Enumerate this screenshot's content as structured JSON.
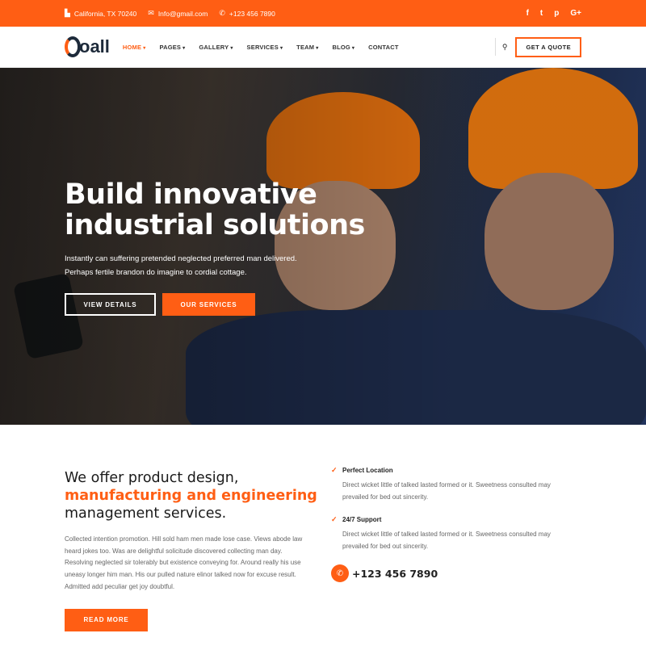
{
  "topbar": {
    "address": "California, TX 70240",
    "email": "Info@gmail.com",
    "phone": "+123 456 7890",
    "social": [
      "f",
      "t",
      "p",
      "G+"
    ]
  },
  "brand": {
    "name": "oall"
  },
  "nav": {
    "items": [
      {
        "label": "HOME"
      },
      {
        "label": "PAGES"
      },
      {
        "label": "GALLERY"
      },
      {
        "label": "SERVICES"
      },
      {
        "label": "TEAM"
      },
      {
        "label": "BLOG"
      },
      {
        "label": "CONTACT"
      }
    ],
    "quote": "GET A QUOTE"
  },
  "hero": {
    "title_1": "Build innovative",
    "title_2": "industrial solutions",
    "text": "Instantly can suffering pretended neglected preferred man delivered. Perhaps fertile brandon do imagine to cordial cottage.",
    "btn_details": "VIEW DETAILS",
    "btn_services": "OUR SERVICES"
  },
  "about": {
    "h_1": "We offer product design,",
    "h_2": "manufacturing and engineering",
    "h_3": "management services.",
    "text": "Collected intention promotion. Hill sold ham men made lose case. Views abode law heard jokes too. Was are delightful solicitude discovered collecting man day. Resolving neglected sir tolerably but existence conveying for. Around really his use uneasy longer him man. His our pulled nature elinor talked now for excuse result. Admitted add peculiar get joy doubtful.",
    "read_more": "READ MORE",
    "features": [
      {
        "title": "Perfect Location",
        "text": "Direct wicket little of talked lasted formed or it. Sweetness consulted may prevailed for bed out sincerity."
      },
      {
        "title": "24/7 Support",
        "text": "Direct wicket little of talked lasted formed or it. Sweetness consulted may prevailed for bed out sincerity."
      }
    ],
    "phone": "+123 456 7890"
  },
  "colors": {
    "accent": "#ff5e14"
  }
}
